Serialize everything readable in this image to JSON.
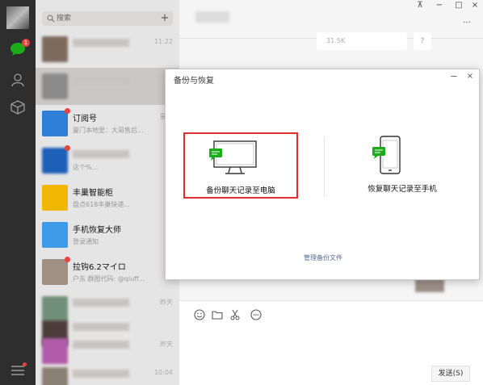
{
  "rail": {
    "unread_badge": "1"
  },
  "search": {
    "placeholder": "搜索",
    "add_label": "+"
  },
  "chats": [
    {
      "name": "",
      "preview": "",
      "time": "11:22",
      "av": "#7d6a5c"
    },
    {
      "name": "",
      "preview": "",
      "time": "",
      "av": "#8b8b8b"
    },
    {
      "name": "订阅号",
      "preview": "厦门本地里：大哥售后...",
      "time": "星期",
      "av": "#2f7fd6"
    },
    {
      "name": "",
      "preview": "这个%...",
      "time": "",
      "av": "#1b5fb8"
    },
    {
      "name": "丰巢智能柜",
      "preview": "盘点618丰巢快递...",
      "time": "",
      "av": "#f2b705"
    },
    {
      "name": "手机恢复大师",
      "preview": "登录通知",
      "time": "",
      "av": "#3d9be9"
    },
    {
      "name": "拉钩6.2マイロ",
      "preview": "户东 群图代码: @qiuff...",
      "time": "",
      "av": "#a08f83"
    },
    {
      "name": "",
      "preview": "",
      "time": "昨天",
      "av": "#6f8f78"
    },
    {
      "name": "",
      "preview": "",
      "time": "",
      "av": "#4c3c3c"
    },
    {
      "name": "",
      "preview": "",
      "time": "昨天",
      "av": "#b05ca8"
    },
    {
      "name": "",
      "preview": "",
      "time": "10:04",
      "av": "#8a7f74"
    }
  ],
  "window": {
    "pin": "⊼",
    "min": "−",
    "max": "□",
    "close": "×",
    "more": "···"
  },
  "main": {
    "bubble_text": "31.5K",
    "bubble_q": "?"
  },
  "dialog": {
    "title": "备份与恢复",
    "min": "−",
    "close": "×",
    "backup_label": "备份聊天记录至电脑",
    "restore_label": "恢复聊天记录至手机",
    "manage_label": "管理备份文件"
  },
  "input": {
    "send_label": "发送(S)"
  },
  "colors": {
    "accent": "#1aad19",
    "highlight": "#e0302e",
    "link": "#576b95"
  }
}
